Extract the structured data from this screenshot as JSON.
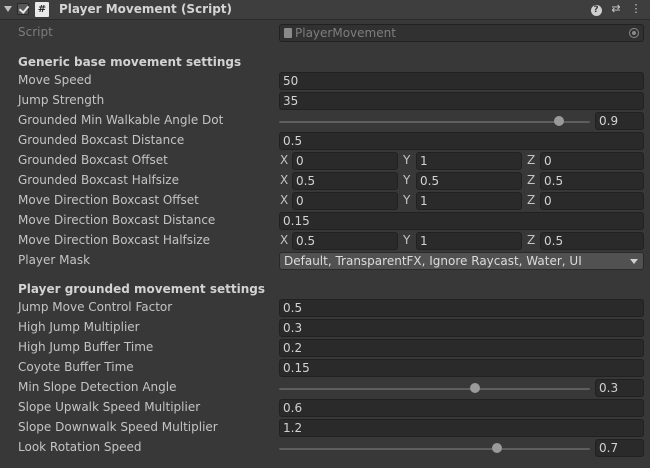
{
  "header": {
    "title": "Player Movement (Script)",
    "script_glyph": "#",
    "help_glyph": "?",
    "presets_glyph": "⇄",
    "more_glyph": "⋮"
  },
  "script": {
    "label": "Script",
    "value": "PlayerMovement"
  },
  "section1": {
    "title": "Generic base movement settings"
  },
  "move_speed": {
    "label": "Move Speed",
    "value": "50"
  },
  "jump_strength": {
    "label": "Jump Strength",
    "value": "35"
  },
  "grounded_min_angle": {
    "label": "Grounded Min Walkable Angle Dot",
    "value": "0.9",
    "level": 0.9
  },
  "grounded_box_distance": {
    "label": "Grounded Boxcast Distance",
    "value": "0.5"
  },
  "grounded_box_offset": {
    "label": "Grounded Boxcast Offset",
    "x": "0",
    "y": "1",
    "z": "0"
  },
  "grounded_box_halfsize": {
    "label": "Grounded Boxcast Halfsize",
    "x": "0.5",
    "y": "0.5",
    "z": "0.5"
  },
  "move_dir_offset": {
    "label": "Move Direction Boxcast Offset",
    "x": "0",
    "y": "1",
    "z": "0"
  },
  "move_dir_distance": {
    "label": "Move Direction Boxcast Distance",
    "value": "0.15"
  },
  "move_dir_halfsize": {
    "label": "Move Direction Boxcast Halfsize",
    "x": "0.5",
    "y": "1",
    "z": "0.5"
  },
  "player_mask": {
    "label": "Player Mask",
    "value": "Default, TransparentFX, Ignore Raycast, Water, UI"
  },
  "section2": {
    "title": "Player grounded movement settings"
  },
  "jump_move_control": {
    "label": "Jump Move Control Factor",
    "value": "0.5"
  },
  "high_jump_mult": {
    "label": "High Jump Multiplier",
    "value": "0.3"
  },
  "high_jump_buffer": {
    "label": "High Jump Buffer Time",
    "value": "0.2"
  },
  "coyote_buffer": {
    "label": "Coyote Buffer Time",
    "value": "0.15"
  },
  "min_slope_angle": {
    "label": "Min Slope Detection Angle",
    "value": "0.3",
    "level": 0.63
  },
  "slope_up_mult": {
    "label": "Slope Upwalk Speed Multiplier",
    "value": "0.6"
  },
  "slope_down_mult": {
    "label": "Slope Downwalk Speed Multiplier",
    "value": "1.2"
  },
  "look_rotation": {
    "label": "Look Rotation Speed",
    "value": "0.7",
    "level": 0.7
  },
  "axes": {
    "x": "X",
    "y": "Y",
    "z": "Z"
  }
}
